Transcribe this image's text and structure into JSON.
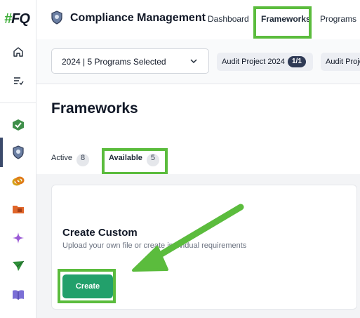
{
  "sidebar": {
    "logo_hash": "#",
    "logo_text": "FQ",
    "icons": [
      "home-icon",
      "task-list-icon",
      "check-cube-icon",
      "shield-icon",
      "link-icon",
      "folder-icon",
      "sparkle-icon",
      "send-icon",
      "book-icon"
    ]
  },
  "header": {
    "title": "Compliance Management",
    "tabs": [
      "Dashboard",
      "Frameworks",
      "Programs"
    ],
    "active_tab": "Frameworks"
  },
  "filter_bar": {
    "program_select_value": "2024 | 5 Programs Selected",
    "chips": [
      {
        "label": "Audit Project 2024",
        "count": "1/1"
      },
      {
        "label": "Audit Proje",
        "count": ""
      }
    ]
  },
  "main": {
    "page_title": "Frameworks",
    "tabs": [
      {
        "label": "Active",
        "count": "8"
      },
      {
        "label": "Available",
        "count": "5"
      }
    ],
    "card": {
      "title": "Create Custom",
      "description": "Upload your own file or create individual requirements",
      "button_label": "Create"
    }
  },
  "colors": {
    "highlight": "#5bbc3d",
    "primary_button": "#22a06b",
    "count_badge": "#2f3a55"
  }
}
